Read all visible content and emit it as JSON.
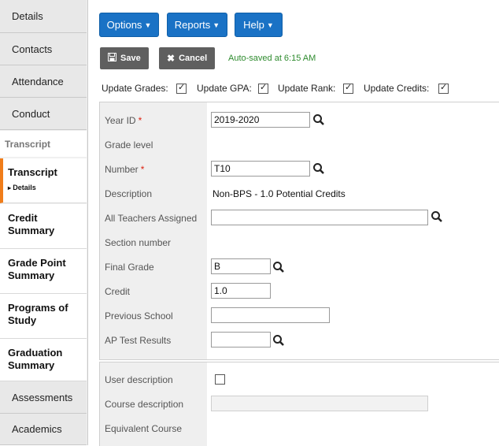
{
  "sidebar": {
    "tabs_top": [
      "Details",
      "Contacts",
      "Attendance",
      "Conduct"
    ],
    "section": "Transcript",
    "subtabs": [
      {
        "label": "Transcript",
        "sub": "Details"
      },
      {
        "label": "Credit Summary"
      },
      {
        "label": "Grade Point Summary"
      },
      {
        "label": "Programs of Study"
      },
      {
        "label": "Graduation Summary"
      }
    ],
    "tabs_bottom": [
      "Assessments",
      "Academics"
    ]
  },
  "toolbar": {
    "options": "Options",
    "reports": "Reports",
    "help": "Help",
    "save": "Save",
    "cancel": "Cancel",
    "autosave": "Auto-saved at 6:15 AM"
  },
  "updates": {
    "grades": "Update Grades:",
    "gpa": "Update GPA:",
    "rank": "Update Rank:",
    "credits": "Update Credits:"
  },
  "form": {
    "year_id_label": "Year ID",
    "year_id_value": "2019-2020",
    "grade_level_label": "Grade level",
    "number_label": "Number",
    "number_value": "T10",
    "description_label": "Description",
    "description_value": "Non-BPS - 1.0 Potential Credits",
    "teachers_label": "All Teachers Assigned",
    "teachers_value": "",
    "section_label": "Section number",
    "final_grade_label": "Final Grade",
    "final_grade_value": "B",
    "credit_label": "Credit",
    "credit_value": "1.0",
    "prev_school_label": "Previous School",
    "prev_school_value": "",
    "ap_label": "AP Test Results",
    "ap_value": "",
    "user_desc_label": "User description",
    "course_desc_label": "Course description",
    "course_desc_value": "",
    "equiv_label": "Equivalent Course",
    "required_mark": "*"
  }
}
